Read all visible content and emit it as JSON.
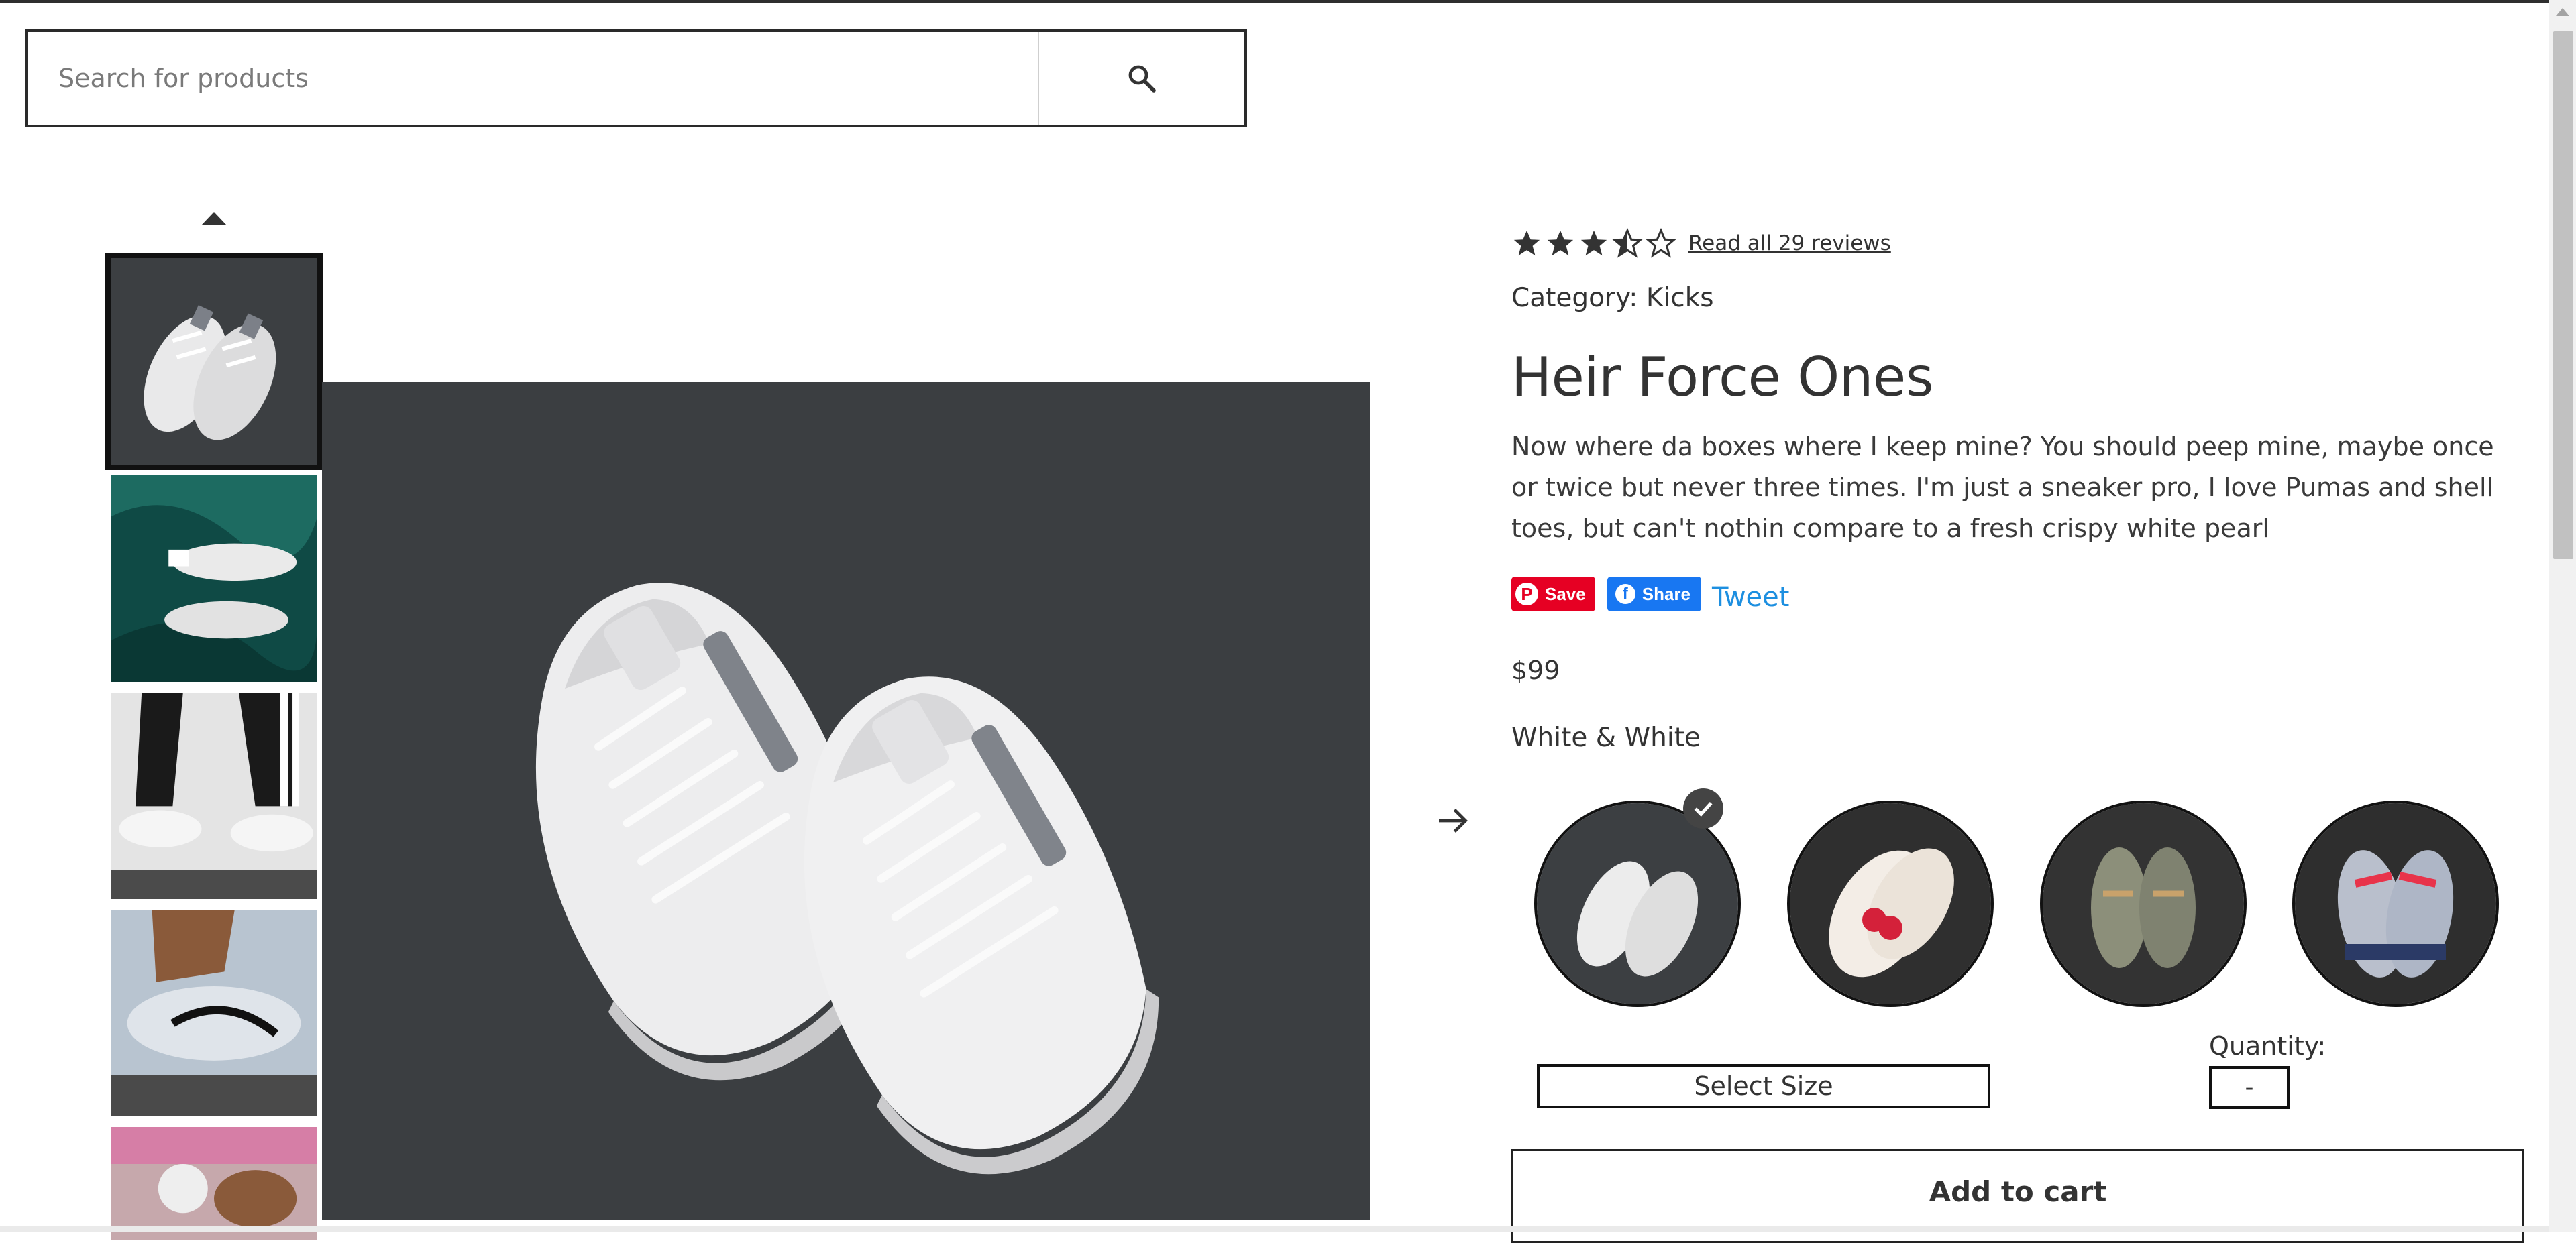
{
  "search": {
    "placeholder": "Search for products",
    "icon": "search-icon"
  },
  "gallery": {
    "thumbnails": [
      {
        "alt": "white sneakers on dark background",
        "selected": true
      },
      {
        "alt": "white sneakers on green velvet",
        "selected": false
      },
      {
        "alt": "person wearing white sneakers and track pants",
        "selected": false
      },
      {
        "alt": "close-up of grey sneaker",
        "selected": false
      },
      {
        "alt": "person holding coffee and food",
        "selected": false
      }
    ]
  },
  "product": {
    "rating": 3.5,
    "rating_max": 5,
    "reviews_link": "Read all 29 reviews",
    "category": "Category: Kicks",
    "title": "Heir Force Ones",
    "description": "Now where da boxes where I keep mine? You should peep mine, maybe once or twice but never three times. I'm just a sneaker pro, I love Pumas and shell toes, but can't nothin compare to a fresh crispy white pearl",
    "price": "$99",
    "color_name": "White & White",
    "size_placeholder": "Select Size",
    "quantity_label": "Quantity:",
    "quantity_value": "-",
    "add_to_cart": "Add to cart"
  },
  "social": {
    "pinterest_label": "Save",
    "facebook_label": "Share",
    "twitter_label": "Tweet"
  },
  "colors": {
    "pinterest": "#e60023",
    "facebook": "#1877f2",
    "twitter": "#1d8fe0",
    "text": "#333333"
  }
}
